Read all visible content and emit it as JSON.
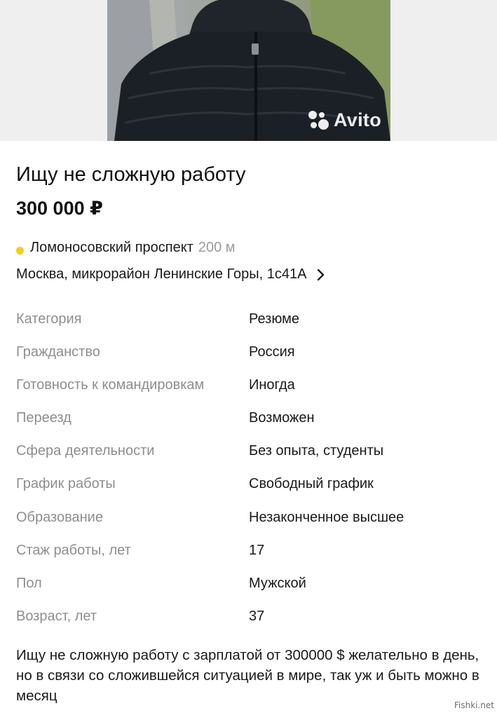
{
  "listing": {
    "photo_watermark": "Avito",
    "title": "Ищу не сложную работу",
    "price": "300 000 ₽",
    "location": {
      "metro_station": "Ломоносовский проспект",
      "metro_distance": "200 м",
      "metro_line_color": "#f5cd1c",
      "address": "Москва, микрорайон Ленинские Горы, 1с41А"
    },
    "parameters": [
      {
        "label": "Категория",
        "value": "Резюме"
      },
      {
        "label": "Гражданство",
        "value": "Россия"
      },
      {
        "label": "Готовность к командировкам",
        "value": "Иногда"
      },
      {
        "label": "Переезд",
        "value": "Возможен"
      },
      {
        "label": "Сфера деятельности",
        "value": "Без опыта, студенты"
      },
      {
        "label": "График работы",
        "value": "Свободный график"
      },
      {
        "label": "Образование",
        "value": "Незаконченное высшее"
      },
      {
        "label": "Стаж работы, лет",
        "value": "17"
      },
      {
        "label": "Пол",
        "value": "Мужской"
      },
      {
        "label": "Возраст, лет",
        "value": "37"
      }
    ],
    "description": "Ищу не сложную работу с зарплатой от 300000 $ желательно в день, но в связи со сложившейся ситуацией в мире, так уж и быть можно  в месяц"
  },
  "source_watermark": "Fishki.net"
}
